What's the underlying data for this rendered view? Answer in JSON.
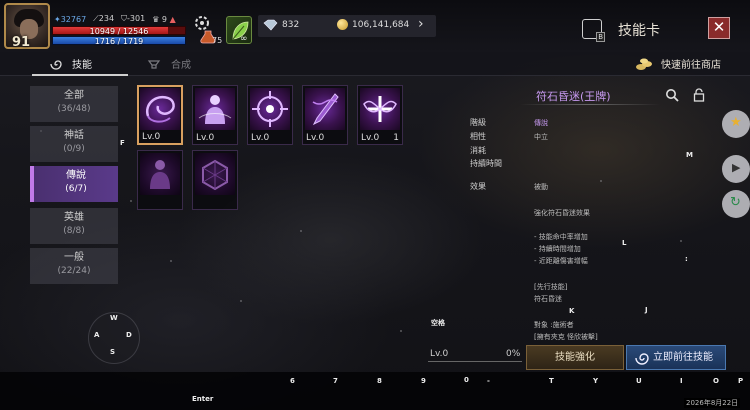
{
  "player": {
    "level": "91",
    "stat_blue": "32767",
    "stat_atk": "234",
    "stat_def": "-301",
    "stat_trophy": "9",
    "hp": "10949 / 12546",
    "hp_ratio": 0.873,
    "mp": "1716 / 1719",
    "mp_ratio": 0.998,
    "potion_count": "75",
    "buff_label": "∞"
  },
  "currency": {
    "gems": "832",
    "gold": "106,141,684"
  },
  "header": {
    "title": "技能卡",
    "hotkey": "B"
  },
  "tabs": {
    "skill": "技能",
    "synth": "合成"
  },
  "shop_link": "快速前往商店",
  "categories": [
    {
      "name": "全部",
      "count": "(36/48)"
    },
    {
      "name": "神話",
      "count": "(0/9)"
    },
    {
      "name": "傳說",
      "count": "(6/7)"
    },
    {
      "name": "英雄",
      "count": "(8/8)"
    },
    {
      "name": "一般",
      "count": "(22/24)"
    }
  ],
  "cards": [
    {
      "level": "Lv.0",
      "count": "",
      "icon": "swirl-icon"
    },
    {
      "level": "Lv.0",
      "count": "",
      "icon": "figure-glow-icon"
    },
    {
      "level": "Lv.0",
      "count": "",
      "icon": "burst-icon"
    },
    {
      "level": "Lv.0",
      "count": "",
      "icon": "chain-sword-icon"
    },
    {
      "level": "Lv.0",
      "count": "1",
      "icon": "cross-wings-icon"
    },
    {
      "level": "",
      "count": "",
      "icon": "silhouette-icon"
    },
    {
      "level": "",
      "count": "",
      "icon": "cube-icon"
    }
  ],
  "detail": {
    "name": "符石昏迷(王牌)",
    "grade_label": "階級",
    "grade": "傳說",
    "affinity_label": "相性",
    "affinity": "中立",
    "cost_label": "消耗",
    "duration_label": "持續時間",
    "effect_label": "效果",
    "effect": "被動",
    "desc": "強化符石昏迷效果",
    "b1": "- 技能命中率增加",
    "b2": "- 持續時間增加",
    "b3": "- 近距離傷害增幅",
    "pre_label": "[先行技能]",
    "pre": "符石昏迷",
    "target": "對象 :施術者",
    "cond": "[擁有夾克 怪欣被擊]"
  },
  "progress": {
    "level": "Lv.0",
    "percent": "0%"
  },
  "buttons": {
    "upgrade": "技能強化",
    "goto": "立即前往技能"
  },
  "keys": {
    "f": "F",
    "m": "M",
    "l": "L",
    "colon": ":",
    "k": "K",
    "j": "J",
    "space": "空格",
    "w": "W",
    "a": "A",
    "d": "D",
    "s": "S",
    "enter": "Enter",
    "n6": "6",
    "n7": "7",
    "n8": "8",
    "n9": "9",
    "n0": "0",
    "dash": "-",
    "t": "T",
    "y": "Y",
    "u": "U",
    "i": "I",
    "o": "O",
    "p": "P"
  },
  "date": "2026年8月22日",
  "colors": {
    "accent_purple": "#c79af0",
    "close_red": "#8a2b2b",
    "goto_blue": "#2a4a78"
  }
}
